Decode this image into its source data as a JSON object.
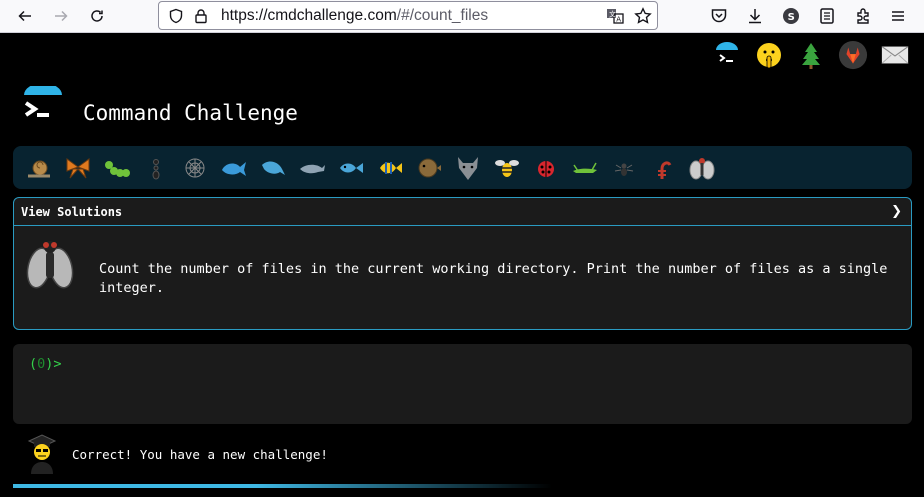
{
  "browser": {
    "url_host": "https://cmdchallenge.com",
    "url_path": "/#/count_files"
  },
  "page": {
    "title": "Command Challenge",
    "top_icons": [
      "cmdchallenge-logo-icon",
      "shushing-face-icon",
      "tree-icon",
      "gitlab-icon",
      "mail-icon"
    ],
    "animals": [
      "snail",
      "butterfly",
      "caterpillar",
      "ant",
      "spider-web",
      "whale",
      "dolphin-blue",
      "dolphin",
      "fish",
      "tropical-fish",
      "blowfish",
      "wolf",
      "bee",
      "ladybug",
      "cricket",
      "spider",
      "scorpion",
      "fly"
    ],
    "solutions": {
      "title": "View Solutions",
      "chevron": "❯",
      "description": "Count the number of files in the current working directory. Print the number of files as a single integer."
    },
    "terminal": {
      "prompt_open": "(",
      "prompt_num": "0",
      "prompt_close": ")>"
    },
    "status_message": "Correct! You have a new challenge!",
    "progress": 0.6
  }
}
